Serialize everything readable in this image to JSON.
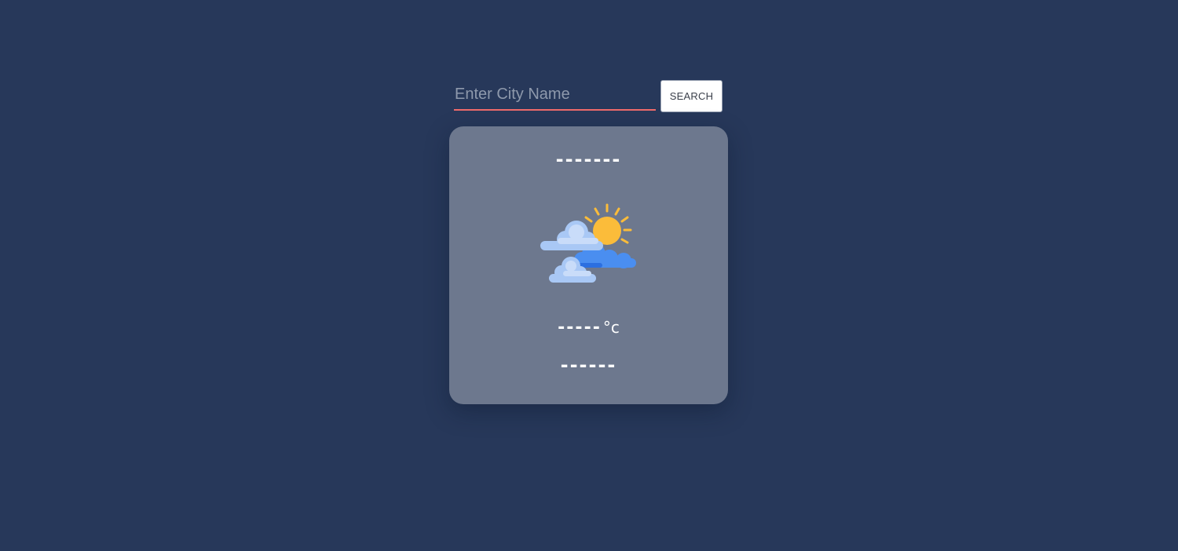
{
  "search": {
    "placeholder": "Enter City Name",
    "value": "",
    "button_label": "SEARCH"
  },
  "weather": {
    "city": "-------",
    "icon": "partly-cloudy-icon",
    "temperature": "-----",
    "unit": "°c",
    "condition": "------"
  },
  "colors": {
    "background": "#27385a",
    "card": "#6d788e",
    "input_underline": "#ef6b6b",
    "sun": "#fbbc3a",
    "cloud_light": "#a9c8f5",
    "cloud_blue": "#4a8ef0"
  }
}
